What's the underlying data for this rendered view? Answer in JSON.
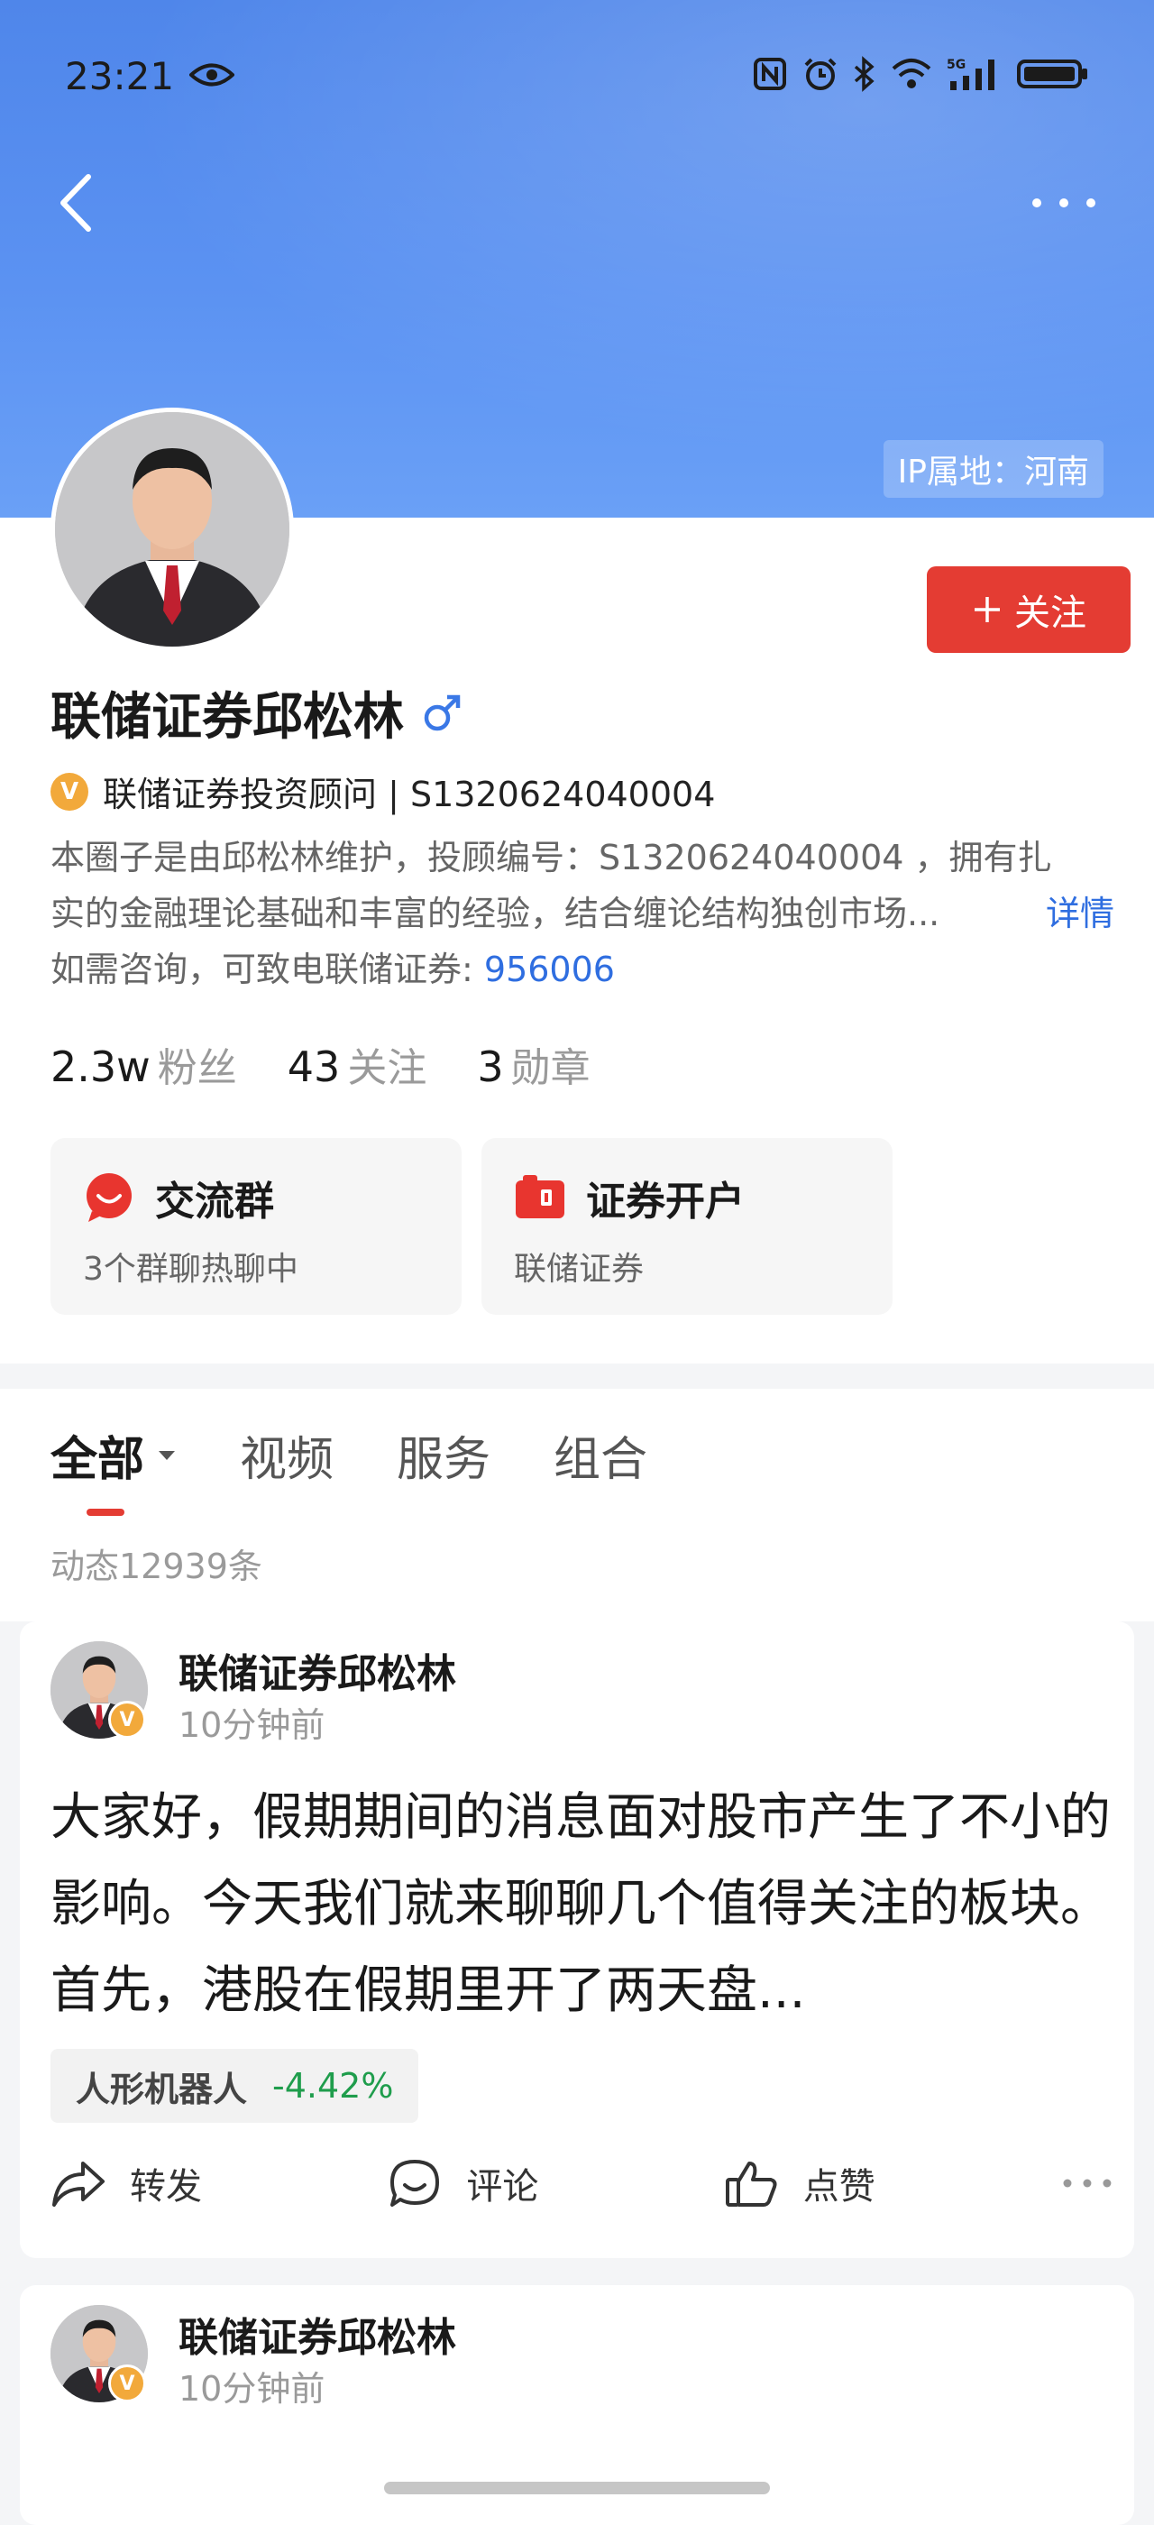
{
  "status_bar": {
    "time": "23:21",
    "icons": [
      "eye-icon",
      "nfc-icon",
      "alarm-icon",
      "bluetooth-icon",
      "wifi-icon",
      "signal-5g-icon",
      "battery-icon"
    ]
  },
  "header": {
    "ip_location": "IP属地：河南",
    "gradient_colors": [
      "#4f86ea",
      "#6aa0f6"
    ]
  },
  "profile": {
    "name": "联储证券邱松林",
    "gender_symbol": "♂",
    "follow_label": "关注",
    "follow_color": "#e43c33",
    "certification": "联储证券投资顾问 | S1320624040004",
    "bio_line1": "本圈子是由邱松林维护，投顾编号：S1320624040004 ，拥有扎",
    "bio_line2": "实的金融理论基础和丰富的经验，结合缠论结构独创市场...",
    "bio_detail": "详情",
    "bio_line3_prefix": "如需咨询，可致电联储证券: ",
    "bio_phone": "956006",
    "stats": [
      {
        "value": "2.3w",
        "label": "粉丝"
      },
      {
        "value": "43",
        "label": "关注"
      },
      {
        "value": "3",
        "label": "勋章"
      }
    ],
    "cards": [
      {
        "title": "交流群",
        "subtitle": "3个群聊热聊中"
      },
      {
        "title": "证券开户",
        "subtitle": "联储证券"
      }
    ]
  },
  "tabs": {
    "items": [
      "全部",
      "视频",
      "服务",
      "组合"
    ],
    "active_index": 0,
    "post_count": "动态12939条"
  },
  "posts": [
    {
      "author": "联储证券邱松林",
      "time": "10分钟前",
      "body": "大家好，假期期间的消息面对股市产生了不小的影响。今天我们就来聊聊几个值得关注的板块。首先，港股在假期里开了两天盘...",
      "tag_name": "人形机器人",
      "tag_value": "-4.42%",
      "actions": {
        "forward": "转发",
        "comment": "评论",
        "like": "点赞"
      }
    },
    {
      "author": "联储证券邱松林",
      "time": "10分钟前"
    }
  ]
}
